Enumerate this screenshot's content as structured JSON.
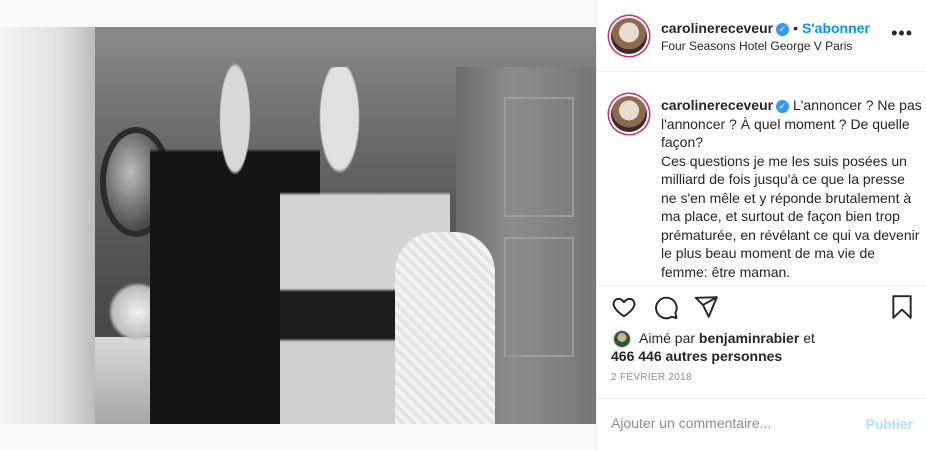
{
  "post": {
    "username": "carolinereceveur",
    "verified_glyph": "✓",
    "dot": "•",
    "follow_label": "S'abonner",
    "location": "Four Seasons Hotel George V Paris",
    "more_label": "•••",
    "photo_icon": "photo-of-couple"
  },
  "caption": {
    "username": "carolinereceveur",
    "paragraph1": "L'annoncer ? Ne pas l'annoncer ? À quel moment ? De quelle façon?",
    "paragraph2": "Ces questions je me les suis posées un milliard de fois jusqu'à ce que la presse ne s'en mêle et y réponde brutalement à ma place, et surtout de façon bien trop prématurée, en révélant ce qui va devenir le plus beau moment de ma vie de femme: être maman."
  },
  "actions": {
    "like_icon": "heart-icon",
    "comment_icon": "comment-icon",
    "share_icon": "share-icon",
    "save_icon": "bookmark-icon"
  },
  "likes": {
    "prefix": "Aimé par",
    "liker": "benjaminrabier",
    "and": "et",
    "others": "466 446 autres personnes"
  },
  "date": "2 FÉVRIER 2018",
  "comment": {
    "placeholder": "Ajouter un commentaire...",
    "publish_label": "Publier"
  },
  "colors": {
    "accent": "#0095f6",
    "publish_disabled": "#b2dffc",
    "verified": "#3897f0",
    "muted": "#8e8e8e"
  }
}
